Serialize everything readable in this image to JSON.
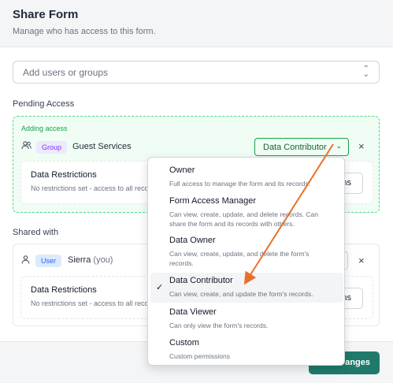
{
  "dialog": {
    "title": "Share Form",
    "subtitle": "Manage who has access to this form."
  },
  "picker": {
    "placeholder": "Add users or groups",
    "arrows_icon": "up-down-chevron-icon"
  },
  "pending": {
    "section_label": "Pending Access",
    "status_label": "Adding access",
    "entry": {
      "icon": "users-icon",
      "badge": "Group",
      "name": "Guest Services",
      "role": "Data Contributor",
      "remove_icon": "×"
    },
    "restrictions": {
      "title": "Data Restrictions",
      "description": "No restrictions set - access to all records",
      "button": "ns"
    }
  },
  "shared": {
    "section_label": "Shared with",
    "entry": {
      "icon": "user-icon",
      "badge": "User",
      "name": "Sierra",
      "you_label": "(you)",
      "remove_icon": "×"
    },
    "restrictions": {
      "title": "Data Restrictions",
      "description": "No restrictions set - access to all records",
      "button": "ns"
    }
  },
  "footer": {
    "save_label": "anges"
  },
  "role_dropdown": {
    "options": [
      {
        "label": "Owner",
        "description": "Full access to manage the form and its records."
      },
      {
        "label": "Form Access Manager",
        "description": "Can view, create, update, and delete records. Can share the form and its records with others."
      },
      {
        "label": "Data Owner",
        "description": "Can view, create, update, and delete the form's records."
      },
      {
        "label": "Data Contributor",
        "description": "Can view, create, and update the form's records."
      },
      {
        "label": "Data Viewer",
        "description": "Can only view the form's records."
      },
      {
        "label": "Custom",
        "description": "Custom permissions"
      }
    ],
    "selected_index": 3,
    "check_icon": "✓"
  },
  "colors": {
    "accent_green": "#16a34a",
    "save_button": "#1f7a6b",
    "annotation_arrow": "#e8702a"
  }
}
